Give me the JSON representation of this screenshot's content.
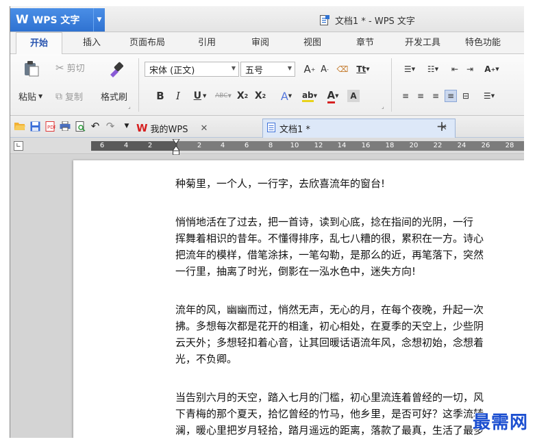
{
  "app": {
    "logo_text": "WPS 文字",
    "doc_title": "文档1 * - WPS 文字"
  },
  "menu": {
    "tabs": [
      "开始",
      "插入",
      "页面布局",
      "引用",
      "审阅",
      "视图",
      "章节",
      "开发工具",
      "特色功能"
    ],
    "active_index": 0
  },
  "ribbon": {
    "clipboard": {
      "paste": "粘贴",
      "cut": "剪切",
      "copy": "复制",
      "format_painter": "格式刷"
    },
    "font": {
      "name": "宋体 (正文)",
      "size": "五号"
    }
  },
  "doc_tabs": {
    "home_tab": "我的WPS",
    "doc_tab": "文档1 *"
  },
  "ruler": {
    "left_ticks": [
      "6",
      "4",
      "2"
    ],
    "right_ticks": [
      "2",
      "4",
      "6",
      "8",
      "10",
      "12",
      "14",
      "16",
      "18",
      "20",
      "22",
      "24",
      "26",
      "28"
    ]
  },
  "document": {
    "paragraphs": [
      [
        "种菊里，一个人，一行字，去欣喜流年的窗台!"
      ],
      [
        "悄悄地活在了过去，把一首诗，读到心底，捻在指间的光阴，一行",
        "挥舞着相识的昔年。不懂得排序，乱七八糟的很，累积在一方。诗心",
        "把流年的模样，借笔涂抹，一笔勾勒，是那么的近，再笔落下，突然",
        "一行里，抽离了时光，倒影在一泓水色中，迷失方向!"
      ],
      [
        "流年的风，幽幽而过，悄然无声，无心的月，在每个夜晚，升起一次",
        "拂。多想每次都是花开的相逢，初心相处，在夏季的天空上，少些阴",
        "云天外；多想轻扣着心音，让其回暖话语流年风，念想初始，念想着",
        "光，不负卿。"
      ],
      [
        "当告别六月的天空，踏入七月的门槛，初心里流连着曾经的一切，风",
        "下青梅的那个夏天，拾忆曾经的竹马，他乡里，是否可好？这季流转",
        "澜，暖心里把岁月轻拾，踏月遥远的距离，落款了最真，生活了最多"
      ]
    ]
  },
  "watermark": "最需网",
  "colors": {
    "accent": "#2f72d1",
    "active_tab_text": "#2a56b0",
    "watermark": "#1c4fd0"
  }
}
